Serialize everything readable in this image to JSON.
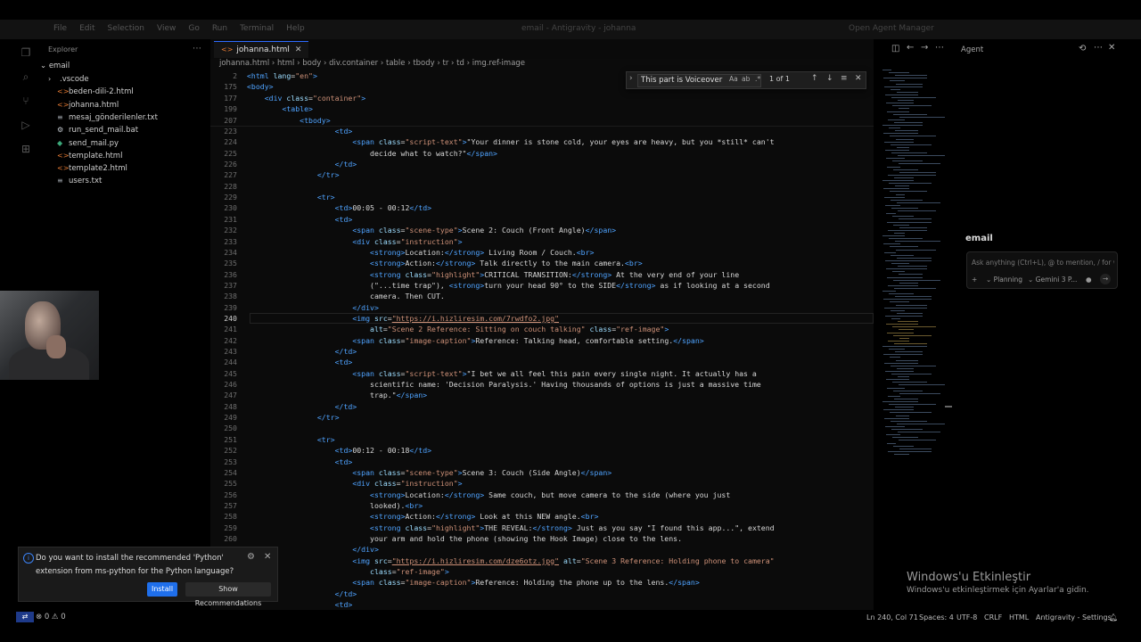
{
  "window": {
    "menu": [
      "File",
      "Edit",
      "Selection",
      "View",
      "Go",
      "Run",
      "Terminal",
      "Help"
    ],
    "title": "email - Antigravity - johanna",
    "right_title": "Open Agent Manager"
  },
  "activity_icons": [
    "files-icon",
    "search-icon",
    "source-control-icon",
    "run-debug-icon",
    "extensions-icon"
  ],
  "explorer": {
    "title": "Explorer",
    "root": "email",
    "items": [
      {
        "name": ".vscode",
        "icon": "chevron-right-icon",
        "color": "#c9c9c9"
      },
      {
        "name": "beden-dili-2.html",
        "icon": "html-file-icon",
        "color": "#e37933"
      },
      {
        "name": "johanna.html",
        "icon": "html-file-icon",
        "color": "#e37933"
      },
      {
        "name": "mesaj_gönderilenler.txt",
        "icon": "text-file-icon",
        "color": "#9aa0a6"
      },
      {
        "name": "run_send_mail.bat",
        "icon": "bat-file-icon",
        "color": "#c1c7cd"
      },
      {
        "name": "send_mail.py",
        "icon": "python-file-icon",
        "color": "#3ca87a"
      },
      {
        "name": "template.html",
        "icon": "html-file-icon",
        "color": "#e37933"
      },
      {
        "name": "template2.html",
        "icon": "html-file-icon",
        "color": "#e37933"
      },
      {
        "name": "users.txt",
        "icon": "text-file-icon",
        "color": "#9aa0a6"
      }
    ]
  },
  "editor": {
    "tab": "johanna.html",
    "breadcrumb": [
      "johanna.html",
      "html",
      "body",
      "div.container",
      "table",
      "tbody",
      "tr",
      "td",
      "img.ref-image"
    ],
    "find": {
      "query": "This part is Voiceover",
      "options": [
        "Aa",
        "ab",
        ".*"
      ],
      "count": "1 of 1"
    },
    "sticky_lines": [
      {
        "n": "2",
        "indent": 0,
        "parts": [
          [
            "tg",
            "<html "
          ],
          [
            "at",
            "lang"
          ],
          [
            "t",
            "="
          ],
          [
            "st",
            "\"en\""
          ],
          [
            "tg",
            ">"
          ]
        ]
      },
      {
        "n": "175",
        "indent": 0,
        "parts": [
          [
            "tg",
            "<body>"
          ]
        ]
      },
      {
        "n": "177",
        "indent": 2,
        "parts": [
          [
            "tg",
            "<div "
          ],
          [
            "at",
            "class"
          ],
          [
            "t",
            "="
          ],
          [
            "st",
            "\"container\""
          ],
          [
            "tg",
            ">"
          ]
        ]
      },
      {
        "n": "199",
        "indent": 4,
        "parts": [
          [
            "tg",
            "<table>"
          ]
        ]
      },
      {
        "n": "207",
        "indent": 6,
        "parts": [
          [
            "tg",
            "<tbody>"
          ]
        ]
      }
    ],
    "lines": [
      {
        "n": "223",
        "indent": 10,
        "parts": [
          [
            "tg",
            "<td>"
          ]
        ]
      },
      {
        "n": "224",
        "indent": 12,
        "parts": [
          [
            "tg",
            "<span "
          ],
          [
            "at",
            "class"
          ],
          [
            "t",
            "="
          ],
          [
            "st",
            "\"script-text\""
          ],
          [
            "tg",
            ">"
          ],
          [
            "t",
            "\"Your dinner is stone cold, your eyes are heavy, but you *still* can't"
          ]
        ]
      },
      {
        "n": "225",
        "indent": 14,
        "parts": [
          [
            "t",
            "decide what to watch?\""
          ],
          [
            "tg",
            "</span>"
          ]
        ]
      },
      {
        "n": "226",
        "indent": 10,
        "parts": [
          [
            "tg",
            "</td>"
          ]
        ]
      },
      {
        "n": "227",
        "indent": 8,
        "parts": [
          [
            "tg",
            "</tr>"
          ]
        ]
      },
      {
        "n": "228",
        "indent": 0,
        "parts": []
      },
      {
        "n": "229",
        "indent": 8,
        "parts": [
          [
            "tg",
            "<tr>"
          ]
        ]
      },
      {
        "n": "230",
        "indent": 10,
        "parts": [
          [
            "tg",
            "<td>"
          ],
          [
            "t",
            "00:05 - 00:12"
          ],
          [
            "tg",
            "</td>"
          ]
        ]
      },
      {
        "n": "231",
        "indent": 10,
        "parts": [
          [
            "tg",
            "<td>"
          ]
        ]
      },
      {
        "n": "232",
        "indent": 12,
        "parts": [
          [
            "tg",
            "<span "
          ],
          [
            "at",
            "class"
          ],
          [
            "t",
            "="
          ],
          [
            "st",
            "\"scene-type\""
          ],
          [
            "tg",
            ">"
          ],
          [
            "t",
            "Scene 2: Couch (Front Angle)"
          ],
          [
            "tg",
            "</span>"
          ]
        ]
      },
      {
        "n": "233",
        "indent": 12,
        "parts": [
          [
            "tg",
            "<div "
          ],
          [
            "at",
            "class"
          ],
          [
            "t",
            "="
          ],
          [
            "st",
            "\"instruction\""
          ],
          [
            "tg",
            ">"
          ]
        ]
      },
      {
        "n": "234",
        "indent": 14,
        "parts": [
          [
            "tg",
            "<strong>"
          ],
          [
            "t",
            "Location:"
          ],
          [
            "tg",
            "</strong>"
          ],
          [
            "t",
            " Living Room / Couch."
          ],
          [
            "tg",
            "<br>"
          ]
        ]
      },
      {
        "n": "235",
        "indent": 14,
        "parts": [
          [
            "tg",
            "<strong>"
          ],
          [
            "t",
            "Action:"
          ],
          [
            "tg",
            "</strong>"
          ],
          [
            "t",
            " Talk directly to the main camera."
          ],
          [
            "tg",
            "<br>"
          ]
        ]
      },
      {
        "n": "236",
        "indent": 14,
        "parts": [
          [
            "tg",
            "<strong "
          ],
          [
            "at",
            "class"
          ],
          [
            "t",
            "="
          ],
          [
            "st",
            "\"highlight\""
          ],
          [
            "tg",
            ">"
          ],
          [
            "t",
            "CRITICAL TRANSITION:"
          ],
          [
            "tg",
            "</strong>"
          ],
          [
            "t",
            " At the very end of your line"
          ]
        ]
      },
      {
        "n": "237",
        "indent": 14,
        "parts": [
          [
            "t",
            "(\"...time trap\"), "
          ],
          [
            "tg",
            "<strong>"
          ],
          [
            "t",
            "turn your head 90° to the SIDE"
          ],
          [
            "tg",
            "</strong>"
          ],
          [
            "t",
            " as if looking at a second"
          ]
        ]
      },
      {
        "n": "238",
        "indent": 14,
        "parts": [
          [
            "t",
            "camera. Then CUT."
          ]
        ]
      },
      {
        "n": "239",
        "indent": 12,
        "parts": [
          [
            "tg",
            "</div>"
          ]
        ]
      },
      {
        "n": "240",
        "indent": 12,
        "active": true,
        "parts": [
          [
            "tg",
            "<img "
          ],
          [
            "at",
            "src"
          ],
          [
            "t",
            "="
          ],
          [
            "ur",
            "\"https://i.hizliresim.com/7rwdfo2.jpg\""
          ]
        ]
      },
      {
        "n": "241",
        "indent": 14,
        "parts": [
          [
            "at",
            "alt"
          ],
          [
            "t",
            "="
          ],
          [
            "st",
            "\"Scene 2 Reference: Sitting on couch talking\""
          ],
          [
            "t",
            " "
          ],
          [
            "at",
            "class"
          ],
          [
            "t",
            "="
          ],
          [
            "st",
            "\"ref-image\""
          ],
          [
            "tg",
            ">"
          ]
        ]
      },
      {
        "n": "242",
        "indent": 12,
        "parts": [
          [
            "tg",
            "<span "
          ],
          [
            "at",
            "class"
          ],
          [
            "t",
            "="
          ],
          [
            "st",
            "\"image-caption\""
          ],
          [
            "tg",
            ">"
          ],
          [
            "t",
            "Reference: Talking head, comfortable setting."
          ],
          [
            "tg",
            "</span>"
          ]
        ]
      },
      {
        "n": "243",
        "indent": 10,
        "parts": [
          [
            "tg",
            "</td>"
          ]
        ]
      },
      {
        "n": "244",
        "indent": 10,
        "parts": [
          [
            "tg",
            "<td>"
          ]
        ]
      },
      {
        "n": "245",
        "indent": 12,
        "parts": [
          [
            "tg",
            "<span "
          ],
          [
            "at",
            "class"
          ],
          [
            "t",
            "="
          ],
          [
            "st",
            "\"script-text\""
          ],
          [
            "tg",
            ">"
          ],
          [
            "t",
            "\"I bet we all feel this pain every single night. It actually has a"
          ]
        ]
      },
      {
        "n": "246",
        "indent": 14,
        "parts": [
          [
            "t",
            "scientific name: 'Decision Paralysis.' Having thousands of options is just a massive time"
          ]
        ]
      },
      {
        "n": "247",
        "indent": 14,
        "parts": [
          [
            "t",
            "trap.\""
          ],
          [
            "tg",
            "</span>"
          ]
        ]
      },
      {
        "n": "248",
        "indent": 10,
        "parts": [
          [
            "tg",
            "</td>"
          ]
        ]
      },
      {
        "n": "249",
        "indent": 8,
        "parts": [
          [
            "tg",
            "</tr>"
          ]
        ]
      },
      {
        "n": "250",
        "indent": 0,
        "parts": []
      },
      {
        "n": "251",
        "indent": 8,
        "parts": [
          [
            "tg",
            "<tr>"
          ]
        ]
      },
      {
        "n": "252",
        "indent": 10,
        "parts": [
          [
            "tg",
            "<td>"
          ],
          [
            "t",
            "00:12 - 00:18"
          ],
          [
            "tg",
            "</td>"
          ]
        ]
      },
      {
        "n": "253",
        "indent": 10,
        "parts": [
          [
            "tg",
            "<td>"
          ]
        ]
      },
      {
        "n": "254",
        "indent": 12,
        "parts": [
          [
            "tg",
            "<span "
          ],
          [
            "at",
            "class"
          ],
          [
            "t",
            "="
          ],
          [
            "st",
            "\"scene-type\""
          ],
          [
            "tg",
            ">"
          ],
          [
            "t",
            "Scene 3: Couch (Side Angle)"
          ],
          [
            "tg",
            "</span>"
          ]
        ]
      },
      {
        "n": "255",
        "indent": 12,
        "parts": [
          [
            "tg",
            "<div "
          ],
          [
            "at",
            "class"
          ],
          [
            "t",
            "="
          ],
          [
            "st",
            "\"instruction\""
          ],
          [
            "tg",
            ">"
          ]
        ]
      },
      {
        "n": "256",
        "indent": 14,
        "parts": [
          [
            "tg",
            "<strong>"
          ],
          [
            "t",
            "Location:"
          ],
          [
            "tg",
            "</strong>"
          ],
          [
            "t",
            " Same couch, but move camera to the side (where you just"
          ]
        ]
      },
      {
        "n": "257",
        "indent": 14,
        "parts": [
          [
            "t",
            "looked)."
          ],
          [
            "tg",
            "<br>"
          ]
        ]
      },
      {
        "n": "258",
        "indent": 14,
        "parts": [
          [
            "tg",
            "<strong>"
          ],
          [
            "t",
            "Action:"
          ],
          [
            "tg",
            "</strong>"
          ],
          [
            "t",
            " Look at this NEW angle."
          ],
          [
            "tg",
            "<br>"
          ]
        ]
      },
      {
        "n": "259",
        "indent": 14,
        "parts": [
          [
            "tg",
            "<strong "
          ],
          [
            "at",
            "class"
          ],
          [
            "t",
            "="
          ],
          [
            "st",
            "\"highlight\""
          ],
          [
            "tg",
            ">"
          ],
          [
            "t",
            "THE REVEAL:"
          ],
          [
            "tg",
            "</strong>"
          ],
          [
            "t",
            " Just as you say \"I found this app...\", extend"
          ]
        ]
      },
      {
        "n": "260",
        "indent": 14,
        "parts": [
          [
            "t",
            "your arm and hold the phone (showing the Hook Image) close to the lens."
          ]
        ]
      },
      {
        "n": "",
        "indent": 12,
        "parts": [
          [
            "tg",
            "</div>"
          ]
        ]
      },
      {
        "n": "",
        "indent": 12,
        "parts": [
          [
            "tg",
            "<img "
          ],
          [
            "at",
            "src"
          ],
          [
            "t",
            "="
          ],
          [
            "ur",
            "\"https://i.hizliresim.com/dze6otz.jpg\""
          ],
          [
            "t",
            " "
          ],
          [
            "at",
            "alt"
          ],
          [
            "t",
            "="
          ],
          [
            "st",
            "\"Scene 3 Reference: Holding phone to camera\""
          ]
        ]
      },
      {
        "n": "",
        "indent": 14,
        "parts": [
          [
            "at",
            "class"
          ],
          [
            "t",
            "="
          ],
          [
            "st",
            "\"ref-image\""
          ],
          [
            "tg",
            ">"
          ]
        ]
      },
      {
        "n": "",
        "indent": 12,
        "parts": [
          [
            "tg",
            "<span "
          ],
          [
            "at",
            "class"
          ],
          [
            "t",
            "="
          ],
          [
            "st",
            "\"image-caption\""
          ],
          [
            "tg",
            ">"
          ],
          [
            "t",
            "Reference: Holding the phone up to the lens."
          ],
          [
            "tg",
            "</span>"
          ]
        ]
      },
      {
        "n": "",
        "indent": 10,
        "parts": [
          [
            "tg",
            "</td>"
          ]
        ]
      },
      {
        "n": "",
        "indent": 10,
        "parts": [
          [
            "tg",
            "<td>"
          ]
        ]
      }
    ]
  },
  "agent": {
    "title": "Agent",
    "heading": "email",
    "placeholder": "Ask anything (Ctrl+L), @ to mention, / for wo",
    "plus": "+",
    "mode": "Planning",
    "model": "Gemini 3 P...",
    "mic": "mic-icon",
    "send": "send-icon"
  },
  "notification": {
    "message": "Do you want to install the recommended 'Python' extension from ms-python for the Python language?",
    "install": "Install",
    "show_recs": "Show Recommendations"
  },
  "status": {
    "errors": "⊗ 0 ⚠ 0",
    "position": "Ln 240, Col 71",
    "spaces": "Spaces: 4",
    "encoding": "UTF-8",
    "eol": "CRLF",
    "language": "HTML",
    "settings": "Antigravity - Settings"
  },
  "watermark": {
    "line1": "Windows'u Etkinleştir",
    "line2": "Windows'u etkinleştirmek için Ayarlar'a gidin."
  }
}
